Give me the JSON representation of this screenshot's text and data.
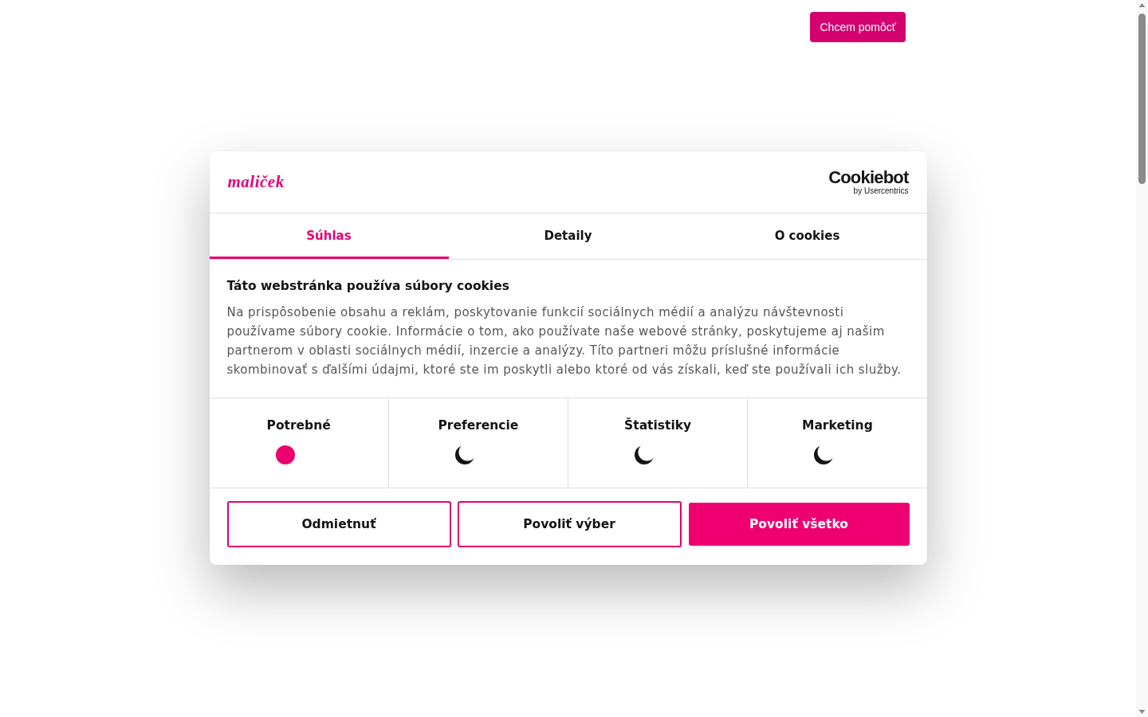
{
  "top_bar": {
    "button": "Chcem pomôcť"
  },
  "dialog": {
    "logo": "maliček",
    "provider_logo": {
      "name": "Cookiebot",
      "tagline": "by Usercentrics"
    },
    "tabs": [
      {
        "label": "Súhlas",
        "selected": true
      },
      {
        "label": "Detaily",
        "selected": false
      },
      {
        "label": "O cookies",
        "selected": false
      }
    ],
    "title": "Táto webstránka používa súbory cookies",
    "description": "Na prispôsobenie obsahu a reklám, poskytovanie funkcií sociálnych médií a analýzu návštevnosti používame súbory cookie. Informácie o tom, ako používate naše webové stránky, poskytujeme aj našim partnerom v oblasti sociálnych médií, inzercie a analýzy. Títo partneri môžu príslušné informácie skombinovať s ďalšími údajmi, ktoré ste im poskytli alebo ktoré od vás získali, keď ste používali ich služby.",
    "categories": [
      {
        "label": "Potrebné",
        "checked": true
      },
      {
        "label": "Preferencie",
        "checked": false
      },
      {
        "label": "Štatistiky",
        "checked": false
      },
      {
        "label": "Marketing",
        "checked": false
      }
    ],
    "buttons": [
      {
        "label": "Odmietnuť",
        "kind": "outline"
      },
      {
        "label": "Povoliť výber",
        "kind": "outline"
      },
      {
        "label": "Povoliť všetko",
        "kind": "filled"
      }
    ]
  }
}
